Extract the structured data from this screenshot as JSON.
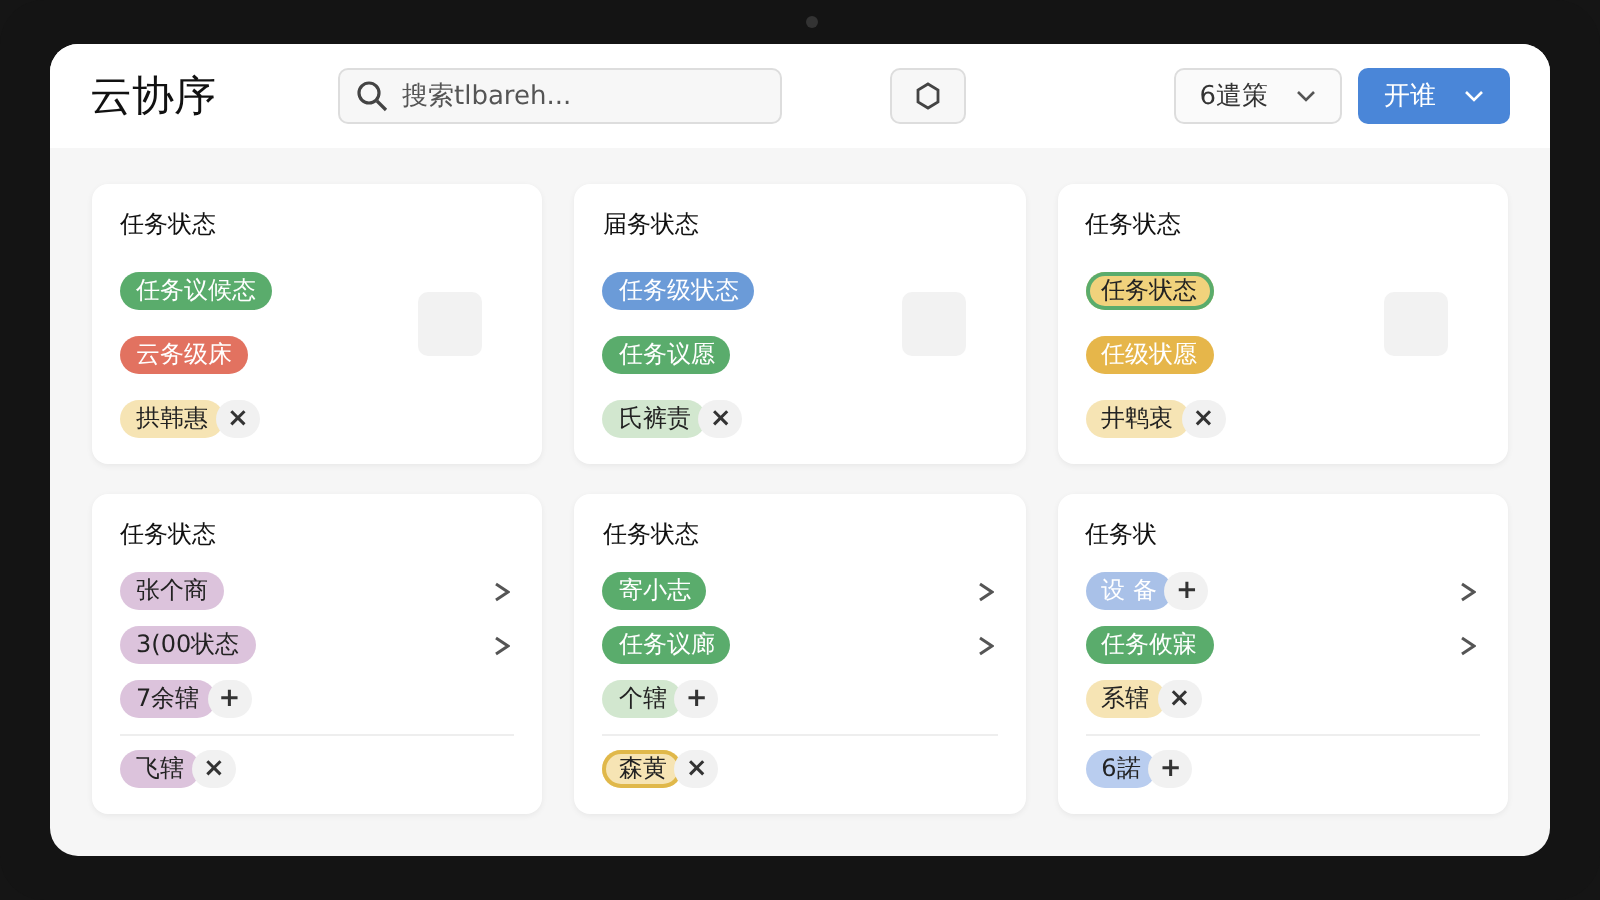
{
  "header": {
    "logo": "云协序",
    "search": {
      "placeholder": "搜索tlbareh..."
    },
    "dropdown": {
      "label": "6遣策"
    },
    "primary_button": {
      "label": "开谁"
    }
  },
  "cards": [
    {
      "title": "任务状态",
      "kind": "simple",
      "rows": [
        {
          "tag": {
            "text": "任务议候态",
            "kind": "solid",
            "color": "#5aac6c"
          }
        },
        {
          "tag": {
            "text": "云务级床",
            "kind": "solid",
            "color": "#e27260"
          }
        },
        {
          "tag": {
            "text": "拱韩惠",
            "kind": "soft",
            "color": "#f6e4b4"
          },
          "action": "×"
        }
      ]
    },
    {
      "title": "届务状态",
      "kind": "simple",
      "rows": [
        {
          "tag": {
            "text": "任务级状态",
            "kind": "solid",
            "color": "#6b9bd8"
          }
        },
        {
          "tag": {
            "text": "任务议愿",
            "kind": "solid",
            "color": "#5aac6c"
          }
        },
        {
          "tag": {
            "text": "氏裤责",
            "kind": "soft",
            "color": "#d2e7cf"
          },
          "action": "×"
        }
      ]
    },
    {
      "title": "任务状态",
      "kind": "simple",
      "rows": [
        {
          "tag": {
            "text": "任务状态",
            "kind": "outlined",
            "color": "#f1d27c"
          }
        },
        {
          "tag": {
            "text": "任级状愿",
            "kind": "solid",
            "color": "#e6b64a"
          }
        },
        {
          "tag": {
            "text": "井鹎衷",
            "kind": "soft",
            "color": "#f6e4b4"
          },
          "action": "×"
        }
      ]
    },
    {
      "title": "任务状态",
      "kind": "list",
      "rows": [
        {
          "tag": {
            "text": "张个商",
            "kind": "soft",
            "color": "#dcc3dc"
          },
          "chevron": true
        },
        {
          "tag": {
            "text": "3(00状态",
            "kind": "soft",
            "color": "#dcc3dc"
          },
          "chevron": true
        },
        {
          "tag": {
            "text": "7余辖",
            "kind": "soft",
            "color": "#dcc3dc"
          },
          "action": "+"
        },
        {
          "tag": {
            "text": "飞辖",
            "kind": "soft",
            "color": "#dcc3dc"
          },
          "action": "×",
          "divider": true
        }
      ]
    },
    {
      "title": "任务状态",
      "kind": "list",
      "rows": [
        {
          "tag": {
            "text": "寄小志",
            "kind": "solid",
            "color": "#5aac6c"
          },
          "chevron": true
        },
        {
          "tag": {
            "text": "任务议廊",
            "kind": "solid",
            "color": "#5aac6c"
          },
          "chevron": true
        },
        {
          "tag": {
            "text": "个辖",
            "kind": "soft",
            "color": "#d2e7cf"
          },
          "action": "+"
        },
        {
          "tag": {
            "text": "森黄",
            "kind": "outlined",
            "color": "#f6e4b4"
          },
          "action": "×",
          "divider": true
        }
      ]
    },
    {
      "title": "任务状",
      "kind": "list",
      "rows": [
        {
          "tag": {
            "text": "设 备",
            "kind": "solid",
            "color": "#a9c1e8"
          },
          "action": "+",
          "chevron": true
        },
        {
          "tag": {
            "text": "任务攸寐",
            "kind": "solid",
            "color": "#5aac6c"
          },
          "chevron": true
        },
        {
          "tag": {
            "text": "系辖",
            "kind": "soft",
            "color": "#f6e4b4"
          },
          "action": "×"
        },
        {
          "tag": {
            "text": "6諾",
            "kind": "soft",
            "color": "#b9cdef"
          },
          "action": "+",
          "divider": true
        }
      ]
    }
  ]
}
